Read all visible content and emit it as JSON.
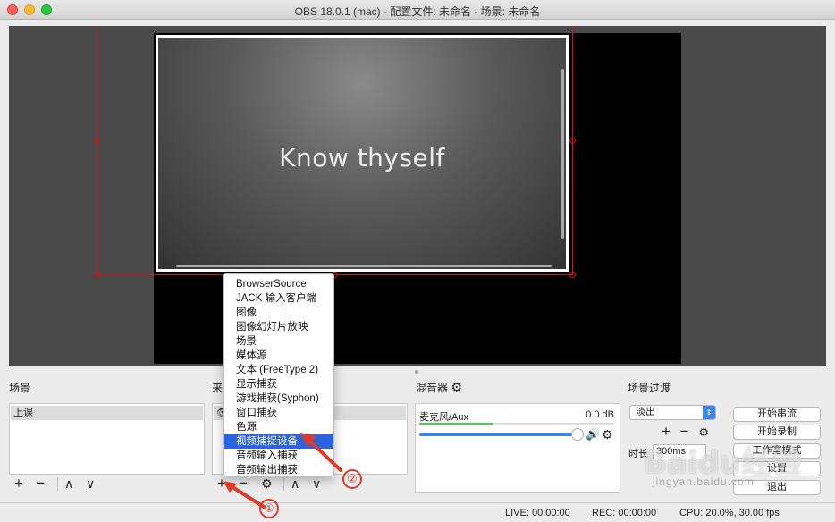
{
  "window": {
    "title": "OBS 18.0.1 (mac) - 配置文件: 未命名 - 场景: 未命名"
  },
  "preview": {
    "slide_text": "Know thyself"
  },
  "docks": {
    "scenes_label": "场景",
    "sources_label": "来",
    "mixer_label": "混音器",
    "transitions_label": "场景过渡"
  },
  "scenes": {
    "items": [
      "上课"
    ]
  },
  "mixer": {
    "channel": "麦克风/Aux",
    "db": "0.0 dB",
    "meter_level": 0.38,
    "fader_level": 0.97
  },
  "transitions": {
    "selected": "淡出",
    "duration_label": "时长",
    "duration_value": "300ms"
  },
  "controls": {
    "start_stream": "开始串流",
    "start_record": "开始录制",
    "studio_mode": "工作室模式",
    "settings": "设置",
    "exit": "退出"
  },
  "status": {
    "live": "LIVE: 00:00:00",
    "rec": "REC: 00:00:00",
    "cpu": "CPU: 20.0%, 30.00 fps"
  },
  "add_source_menu": {
    "items": [
      "BrowserSource",
      "JACK 输入客户端",
      "图像",
      "图像幻灯片放映",
      "场景",
      "媒体源",
      "文本 (FreeType 2)",
      "显示捕获",
      "游戏捕获(Syphon)",
      "窗口捕获",
      "色源",
      "视频捕捉设备",
      "音频输入捕获",
      "音频输出捕获"
    ],
    "highlighted_index": 11
  },
  "annotations": {
    "step1": "①",
    "step2": "②",
    "color": "#e03a2a"
  },
  "watermark": {
    "logo": "Baidu经验",
    "url": "jingyan.baidu.com"
  },
  "colors": {
    "accent": "#3d86e6",
    "menu_highlight": "#2c63e0",
    "selection": "#dd1111"
  }
}
